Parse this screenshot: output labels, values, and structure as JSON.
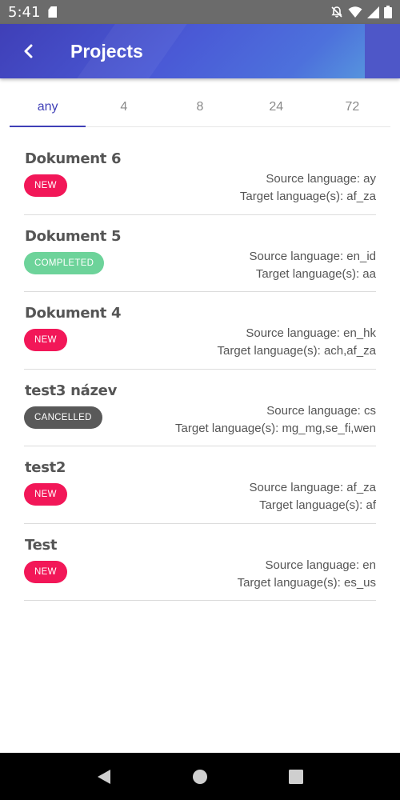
{
  "status_bar": {
    "time": "5:41"
  },
  "app_bar": {
    "title": "Projects"
  },
  "tabs": [
    {
      "label": "any",
      "active": true
    },
    {
      "label": "4",
      "active": false
    },
    {
      "label": "8",
      "active": false
    },
    {
      "label": "24",
      "active": false
    },
    {
      "label": "72",
      "active": false
    }
  ],
  "projects": [
    {
      "name": "Dokument 6",
      "status": "NEW",
      "source": "Source language: ay",
      "target": "Target language(s): af_za"
    },
    {
      "name": "Dokument 5",
      "status": "COMPLETED",
      "source": "Source language: en_id",
      "target": "Target language(s): aa"
    },
    {
      "name": "Dokument 4",
      "status": "NEW",
      "source": "Source language: en_hk",
      "target": "Target language(s): ach,af_za"
    },
    {
      "name": "test3 název",
      "status": "CANCELLED",
      "source": "Source language: cs",
      "target": "Target language(s): mg_mg,se_fi,wen"
    },
    {
      "name": "test2",
      "status": "NEW",
      "source": "Source language: af_za",
      "target": "Target language(s): af"
    },
    {
      "name": "Test",
      "status": "NEW",
      "source": "Source language: en",
      "target": "Target language(s): es_us"
    }
  ],
  "colors": {
    "primary": "#3f3fb7",
    "status_new": "#f21758",
    "status_completed": "#6dd39a",
    "status_cancelled": "#595959"
  },
  "icons": {
    "back": "arrow-back-icon",
    "notifications_off": "bell-off-icon",
    "wifi": "wifi-icon",
    "signal": "cell-signal-icon",
    "battery": "battery-icon",
    "nav_back": "triangle-back-icon",
    "nav_home": "circle-home-icon",
    "nav_recents": "square-recents-icon"
  }
}
